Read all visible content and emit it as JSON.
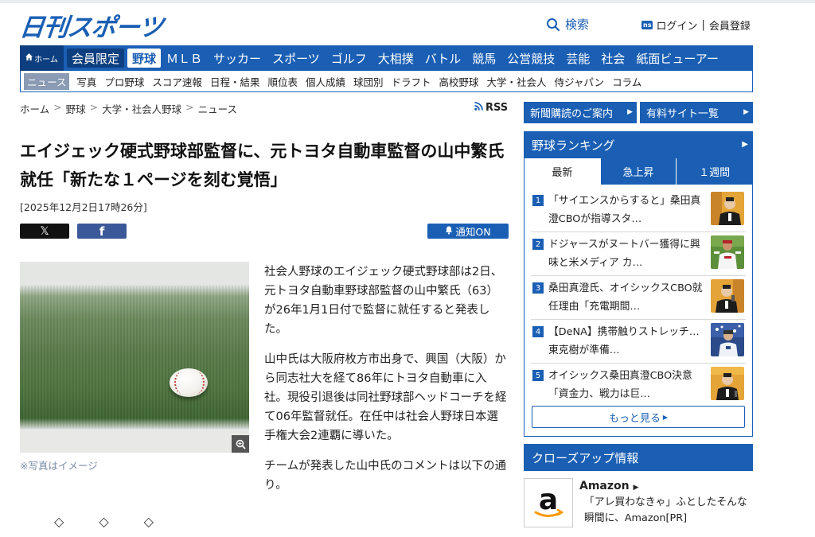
{
  "header": {
    "logo_text": "日刊スポーツ",
    "search_label": "検索",
    "ns_badge": "ns",
    "login_label": "ログイン",
    "register_label": "会員登録"
  },
  "main_nav": {
    "home_label": "ホーム",
    "items": [
      "会員限定",
      "野球",
      "ＭＬＢ",
      "サッカー",
      "スポーツ",
      "ゴルフ",
      "大相撲",
      "バトル",
      "競馬",
      "公営競技",
      "芸能",
      "社会",
      "紙面ビューアー"
    ],
    "active": "野球"
  },
  "sub_nav": {
    "items": [
      "ニュース",
      "写真",
      "プロ野球",
      "スコア速報",
      "日程・結果",
      "順位表",
      "個人成績",
      "球団別",
      "ドラフト",
      "高校野球",
      "大学・社会人",
      "侍ジャパン",
      "コラム"
    ],
    "current": "ニュース"
  },
  "breadcrumb": [
    "ホーム",
    "野球",
    "大学・社会人野球",
    "ニュース"
  ],
  "rss_label": "RSS",
  "article": {
    "title": "エイジェック硬式野球部監督に、元トヨタ自動車監督の山中繁氏就任「新たな１ページを刻む覚悟」",
    "date": "[2025年12月2日17時26分]",
    "share_x": "𝕏",
    "share_fb": "f",
    "notify_label": "通知ON",
    "photo_caption": "※写真はイメージ",
    "paragraphs": [
      "社会人野球のエイジェック硬式野球部は2日、元トヨタ自動車野球部監督の山中繁氏（63）が26年1月1日付で監督に就任すると発表した。",
      "山中氏は大阪府枚方市出身で、興国（大阪）から同志社大を経て86年にトヨタ自動車に入社。現役引退後は同社野球部ヘッドコーチを経て06年監督就任。在任中は社会人野球日本選手権大会2連覇に導いた。",
      "チームが発表した山中氏のコメントは以下の通り。"
    ],
    "diamonds": [
      "◇",
      "◇",
      "◇"
    ]
  },
  "sidebar": {
    "btn_subscribe": "新聞購読のご案内",
    "btn_paid_sites": "有料サイト一覧",
    "ranking_title": "野球ランキング",
    "tabs": [
      "最新",
      "急上昇",
      "１週間"
    ],
    "active_tab": "最新",
    "ranking": [
      {
        "num": "1",
        "text": "「サイエンスからすると」桑田真澄CBOが指導スタ…"
      },
      {
        "num": "2",
        "text": "ドジャースがヌートバー獲得に興味と米メディア カ…"
      },
      {
        "num": "3",
        "text": "桑田真澄氏、オイシックスCBO就任理由「充電期間…"
      },
      {
        "num": "4",
        "text": "【DeNA】携帯触りストレッチ…東克樹が準備…"
      },
      {
        "num": "5",
        "text": "オイシックス桑田真澄CBO決意「資金力、戦力は巨…"
      }
    ],
    "more_label": "もっと見る",
    "closeup_title": "クローズアップ情報",
    "amazon_title": "Amazon",
    "amazon_desc": "「アレ買わなきゃ」ふとしたそんな瞬間に、Amazon[PR]"
  },
  "colors": {
    "brand_blue": "#1a5fb4",
    "dark_blue": "#0d3f80"
  }
}
